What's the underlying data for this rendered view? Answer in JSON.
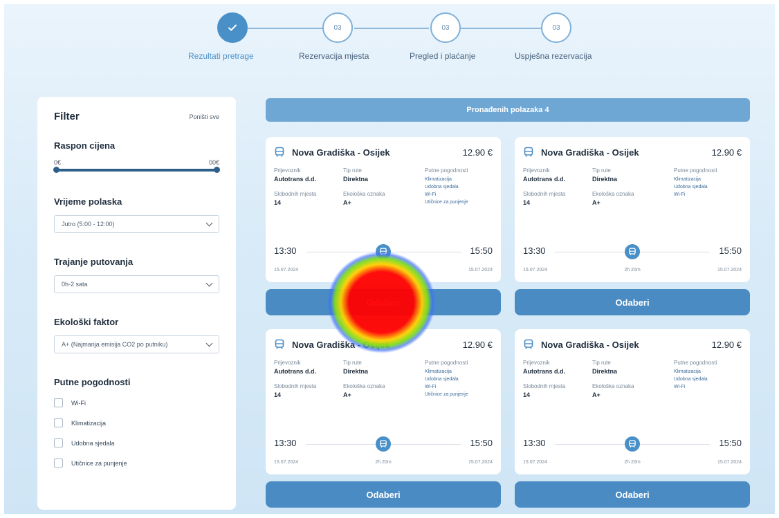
{
  "stepper": {
    "steps": [
      {
        "number": "",
        "label": "Rezultati pretrage",
        "done": true
      },
      {
        "number": "03",
        "label": "Rezervacija mjesta",
        "done": false
      },
      {
        "number": "03",
        "label": "Pregled i plaćanje",
        "done": false
      },
      {
        "number": "03",
        "label": "Uspješna rezervacija",
        "done": false
      }
    ]
  },
  "filter": {
    "title": "Filter",
    "reset_label": "Poništi sve",
    "price_range": {
      "title": "Raspon cijena",
      "min_label": "0€",
      "max_label": "00€"
    },
    "departure": {
      "title": "Vrijeme polaska",
      "selected": "Jutro (5:00 - 12:00)"
    },
    "duration": {
      "title": "Trajanje putovanja",
      "selected": "0h-2 sata"
    },
    "eco": {
      "title": "Ekološki faktor",
      "selected": "A+ (Najmanja emisija CO2 po putniku)"
    },
    "amenities": {
      "title": "Putne pogodnosti",
      "options": [
        "Wi-Fi",
        "Klimatizacija",
        "Udobna sjedala",
        "Utičnice za punjenje"
      ]
    }
  },
  "results": {
    "header": "Pronađenih polazaka 4",
    "select_label": "Odaberi",
    "cards": [
      {
        "route": "Nova Gradiška - Osijek",
        "price": "12.90 €",
        "carrier_label": "Prijevoznik",
        "carrier": "Autotrans d.d.",
        "type_label": "Tip rute",
        "type": "Direktna",
        "amen_label": "Putne pogodnosti",
        "amenities": [
          "Klimatizacija",
          "Udobna sjedala",
          "Wi-Fi",
          "Utičnice za punjenje"
        ],
        "seats_label": "Slobodnih mjesta",
        "seats": "14",
        "eco_label": "Ekološka oznaka",
        "eco": "A+",
        "dep_time": "13:30",
        "arr_time": "15:50",
        "dep_date": "15.07.2024",
        "arr_date": "15.07.2024",
        "duration": "2h 20m"
      },
      {
        "route": "Nova Gradiška - Osijek",
        "price": "12.90 €",
        "carrier_label": "Prijevoznik",
        "carrier": "Autotrans d.d.",
        "type_label": "Tip rute",
        "type": "Direktna",
        "amen_label": "Putne pogodnosti",
        "amenities": [
          "Klimatizacija",
          "Udobna sjedala",
          "Wi-Fi"
        ],
        "seats_label": "Slobodnih mjesta",
        "seats": "14",
        "eco_label": "Ekološka oznaka",
        "eco": "A+",
        "dep_time": "13:30",
        "arr_time": "15:50",
        "dep_date": "15.07.2024",
        "arr_date": "15.07.2024",
        "duration": "2h 20m"
      },
      {
        "route": "Nova Gradiška - Osijek",
        "price": "12.90 €",
        "carrier_label": "Prijevoznik",
        "carrier": "Autotrans d.d.",
        "type_label": "Tip rute",
        "type": "Direktna",
        "amen_label": "Putne pogodnosti",
        "amenities": [
          "Klimatizacija",
          "Udobna sjedala",
          "Wi-Fi",
          "Utičnice za punjenje"
        ],
        "seats_label": "Slobodnih mjesta",
        "seats": "14",
        "eco_label": "Ekološka oznaka",
        "eco": "A+",
        "dep_time": "13:30",
        "arr_time": "15:50",
        "dep_date": "15.07.2024",
        "arr_date": "15.07.2024",
        "duration": "2h 20m"
      },
      {
        "route": "Nova Gradiška - Osijek",
        "price": "12.90 €",
        "carrier_label": "Prijevoznik",
        "carrier": "Autotrans d.d.",
        "type_label": "Tip rute",
        "type": "Direktna",
        "amen_label": "Putne pogodnosti",
        "amenities": [
          "Klimatizacija",
          "Udobna sjedala",
          "Wi-Fi"
        ],
        "seats_label": "Slobodnih mjesta",
        "seats": "14",
        "eco_label": "Ekološka oznaka",
        "eco": "A+",
        "dep_time": "13:30",
        "arr_time": "15:50",
        "dep_date": "15.07.2024",
        "arr_date": "15.07.2024",
        "duration": "2h 20m"
      }
    ]
  },
  "colors": {
    "accent": "#4a8bc4",
    "accent_light": "#6ea6d4",
    "text": "#1f2d3d"
  },
  "icons": {
    "step_done": "check-icon",
    "card": "bus-icon",
    "duration": "bus-icon",
    "dropdown": "chevron-down-icon"
  }
}
